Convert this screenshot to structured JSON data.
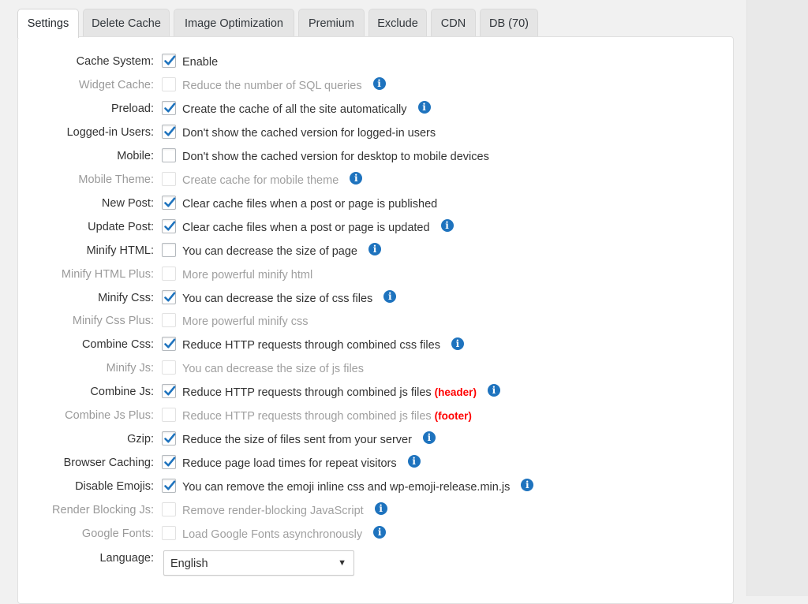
{
  "tabs": [
    "Settings",
    "Delete Cache",
    "Image Optimization",
    "Premium",
    "Exclude",
    "CDN",
    "DB (70)"
  ],
  "options": [
    {
      "label": "Cache System:",
      "desc": "Enable",
      "checked": true,
      "enabled": true,
      "info": false,
      "tag": ""
    },
    {
      "label": "Widget Cache:",
      "desc": "Reduce the number of SQL queries",
      "checked": false,
      "enabled": false,
      "info": true,
      "tag": ""
    },
    {
      "label": "Preload:",
      "desc": "Create the cache of all the site automatically",
      "checked": true,
      "enabled": true,
      "info": true,
      "tag": ""
    },
    {
      "label": "Logged-in Users:",
      "desc": "Don't show the cached version for logged-in users",
      "checked": true,
      "enabled": true,
      "info": false,
      "tag": ""
    },
    {
      "label": "Mobile:",
      "desc": "Don't show the cached version for desktop to mobile devices",
      "checked": false,
      "enabled": true,
      "info": false,
      "tag": ""
    },
    {
      "label": "Mobile Theme:",
      "desc": "Create cache for mobile theme",
      "checked": false,
      "enabled": false,
      "info": true,
      "tag": ""
    },
    {
      "label": "New Post:",
      "desc": "Clear cache files when a post or page is published",
      "checked": true,
      "enabled": true,
      "info": false,
      "tag": ""
    },
    {
      "label": "Update Post:",
      "desc": "Clear cache files when a post or page is updated",
      "checked": true,
      "enabled": true,
      "info": true,
      "tag": ""
    },
    {
      "label": "Minify HTML:",
      "desc": "You can decrease the size of page",
      "checked": false,
      "enabled": true,
      "info": true,
      "tag": ""
    },
    {
      "label": "Minify HTML Plus:",
      "desc": "More powerful minify html",
      "checked": false,
      "enabled": false,
      "info": false,
      "tag": ""
    },
    {
      "label": "Minify Css:",
      "desc": "You can decrease the size of css files",
      "checked": true,
      "enabled": true,
      "info": true,
      "tag": ""
    },
    {
      "label": "Minify Css Plus:",
      "desc": "More powerful minify css",
      "checked": false,
      "enabled": false,
      "info": false,
      "tag": ""
    },
    {
      "label": "Combine Css:",
      "desc": "Reduce HTTP requests through combined css files",
      "checked": true,
      "enabled": true,
      "info": true,
      "tag": ""
    },
    {
      "label": "Minify Js:",
      "desc": "You can decrease the size of js files",
      "checked": false,
      "enabled": false,
      "info": false,
      "tag": ""
    },
    {
      "label": "Combine Js:",
      "desc": "Reduce HTTP requests through combined js files",
      "checked": true,
      "enabled": true,
      "info": true,
      "tag": "(header)"
    },
    {
      "label": "Combine Js Plus:",
      "desc": "Reduce HTTP requests through combined js files",
      "checked": false,
      "enabled": false,
      "info": false,
      "tag": "(footer)"
    },
    {
      "label": "Gzip:",
      "desc": "Reduce the size of files sent from your server",
      "checked": true,
      "enabled": true,
      "info": true,
      "tag": ""
    },
    {
      "label": "Browser Caching:",
      "desc": "Reduce page load times for repeat visitors",
      "checked": true,
      "enabled": true,
      "info": true,
      "tag": ""
    },
    {
      "label": "Disable Emojis:",
      "desc": "You can remove the emoji inline css and wp-emoji-release.min.js",
      "checked": true,
      "enabled": true,
      "info": true,
      "tag": ""
    },
    {
      "label": "Render Blocking Js:",
      "desc": "Remove render-blocking JavaScript",
      "checked": false,
      "enabled": false,
      "info": true,
      "tag": ""
    },
    {
      "label": "Google Fonts:",
      "desc": "Load Google Fonts asynchronously",
      "checked": false,
      "enabled": false,
      "info": true,
      "tag": ""
    }
  ],
  "language": {
    "label": "Language:",
    "value": "English"
  },
  "icons": {
    "info": "info-icon",
    "check": "checkmark-icon",
    "dropdown": "dropdown-arrow-icon"
  },
  "colors": {
    "check": "#1e73be",
    "info": "#1e73be",
    "tag": "#ff0000"
  }
}
